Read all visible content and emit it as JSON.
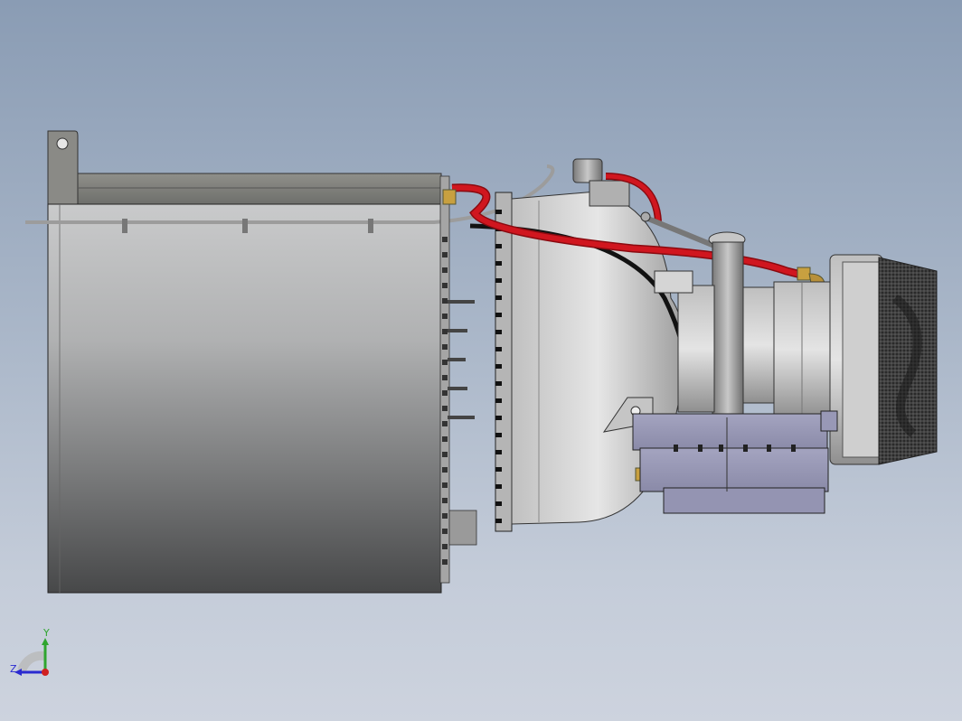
{
  "view": {
    "background_top": "#8a9cb4",
    "background_bottom": "#cdd3de"
  },
  "triad": {
    "y_label": "Y",
    "z_label": "Z",
    "y_color": "#2fa52f",
    "z_color": "#2a2ad0",
    "x_color": "#d02020"
  },
  "model": {
    "hose_color": "#c8101a",
    "cable_color": "#111111",
    "module_color": "#9a9ab8",
    "fitting_color": "#c8a040"
  }
}
